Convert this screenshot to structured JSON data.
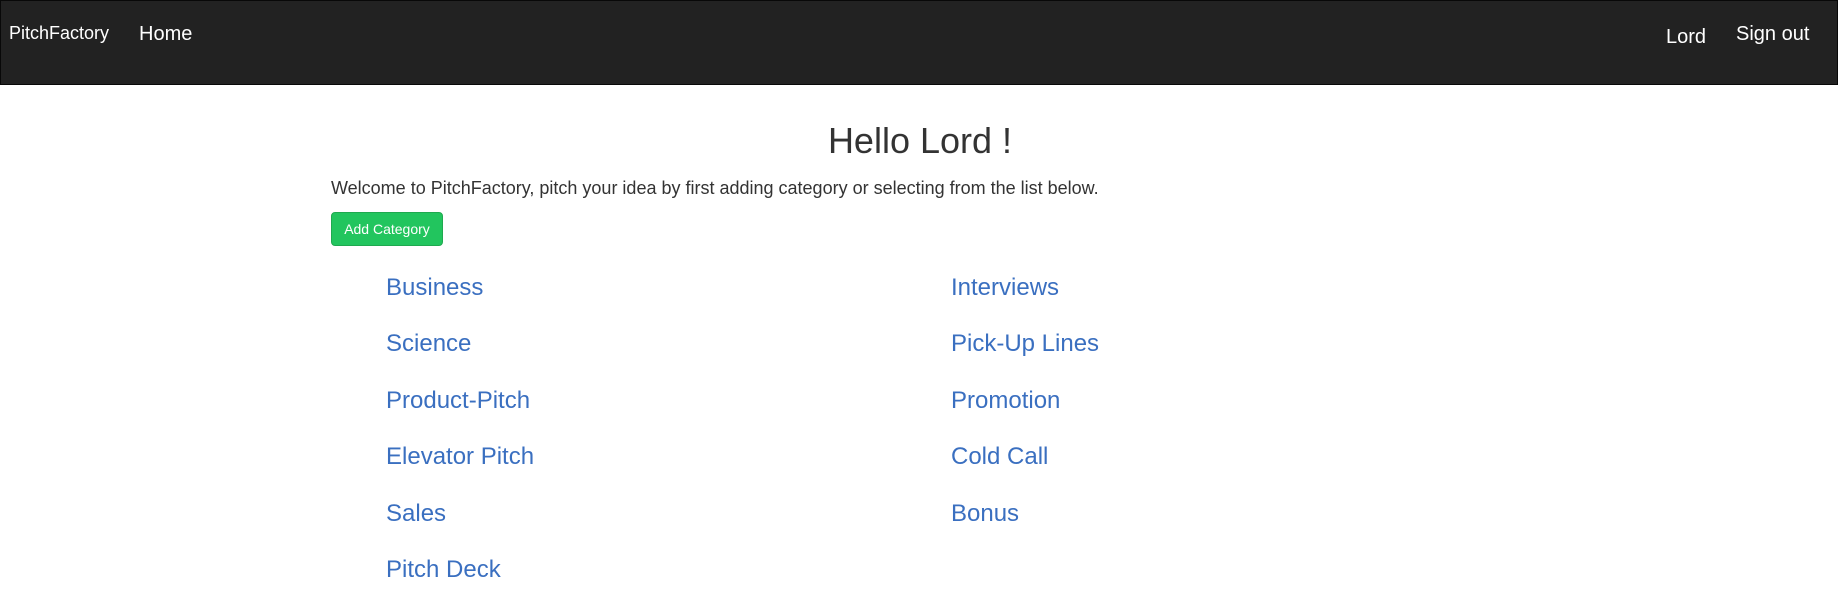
{
  "navbar": {
    "brand": "PitchFactory",
    "home": "Home",
    "user": "Lord",
    "sign_out": "Sign out"
  },
  "main": {
    "greeting": "Hello Lord !",
    "welcome": "Welcome to PitchFactory, pitch your idea by first adding category or selecting from the list below.",
    "add_category_label": "Add Category"
  },
  "categories": {
    "left": [
      "Business",
      "Science",
      "Product-Pitch",
      "Elevator Pitch",
      "Sales",
      "Pitch Deck"
    ],
    "right": [
      "Interviews",
      "Pick-Up Lines",
      "Promotion",
      "Cold Call",
      "Bonus"
    ]
  },
  "colors": {
    "navbar_bg": "#222222",
    "link": "#3a6fc0",
    "button_success": "#22c55e"
  }
}
